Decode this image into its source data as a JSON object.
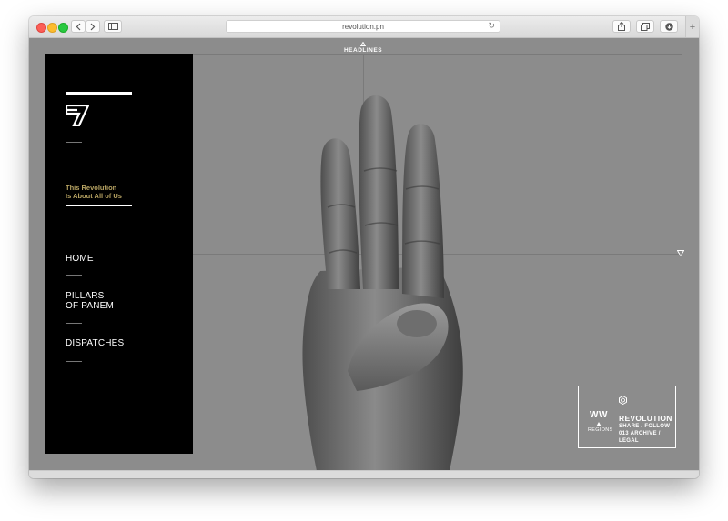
{
  "browser": {
    "address": "revolution.pn",
    "back_icon": "chevron-left",
    "forward_icon": "chevron-right",
    "sidebar_icon": "sidebar",
    "share_icon": "share",
    "tabs_icon": "tabs",
    "download_icon": "download",
    "reload_icon": "reload",
    "new_tab_label": "+"
  },
  "header": {
    "headlines": "HEADLINES"
  },
  "sidebar": {
    "tagline_line1": "This Revolution",
    "tagline_line2": "Is About All of Us",
    "nav": [
      {
        "line1": "HOME",
        "line2": ""
      },
      {
        "line1": "PILLARS",
        "line2": "OF PANEM"
      },
      {
        "line1": "DISPATCHES",
        "line2": ""
      }
    ]
  },
  "infobox": {
    "region_code": "WW",
    "region_label": "REGIONS",
    "title": "REVOLUTION",
    "link1": "SHARE / FOLLOW",
    "link2": "013 ARCHIVE / LEGAL"
  },
  "colors": {
    "accent_gold": "#b8a463",
    "page_bg": "#8c8c8c",
    "sidebar_bg": "#000000"
  }
}
